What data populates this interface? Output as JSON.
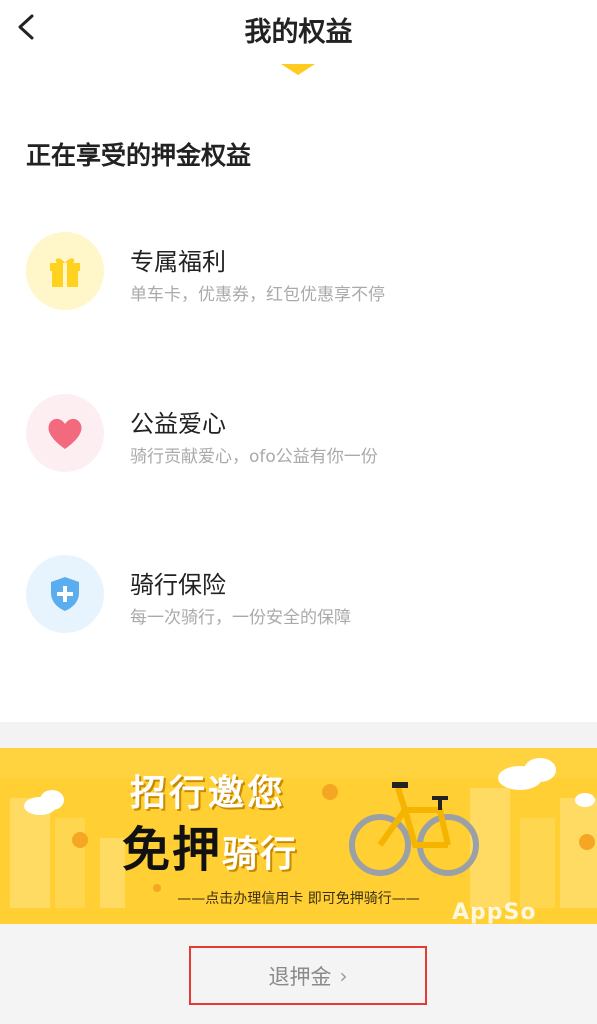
{
  "header": {
    "title": "我的权益"
  },
  "section_title": "正在享受的押金权益",
  "benefits": [
    {
      "title": "专属福利",
      "subtitle": "单车卡，优惠券，红包优惠享不停",
      "icon": "gift-icon",
      "icon_bg": "#fff6c9",
      "icon_color": "#ffd21f"
    },
    {
      "title": "公益爱心",
      "subtitle": "骑行贡献爱心，ofo公益有你一份",
      "icon": "heart-icon",
      "icon_bg": "#fdeff1",
      "icon_color": "#f36a7f"
    },
    {
      "title": "骑行保险",
      "subtitle": "每一次骑行，一份安全的保障",
      "icon": "shield-icon",
      "icon_bg": "#e8f4fd",
      "icon_color": "#5aaef0"
    }
  ],
  "banner": {
    "line1": "招行邀您",
    "line2a": "免押",
    "line2b": "骑行",
    "tagline": "——点击办理信用卡 即可免押骑行——"
  },
  "refund_button": {
    "label": "退押金",
    "chevron": "›"
  },
  "watermark": "AppSo",
  "colors": {
    "accent": "#ffd23f",
    "highlight_border": "#e53935"
  }
}
